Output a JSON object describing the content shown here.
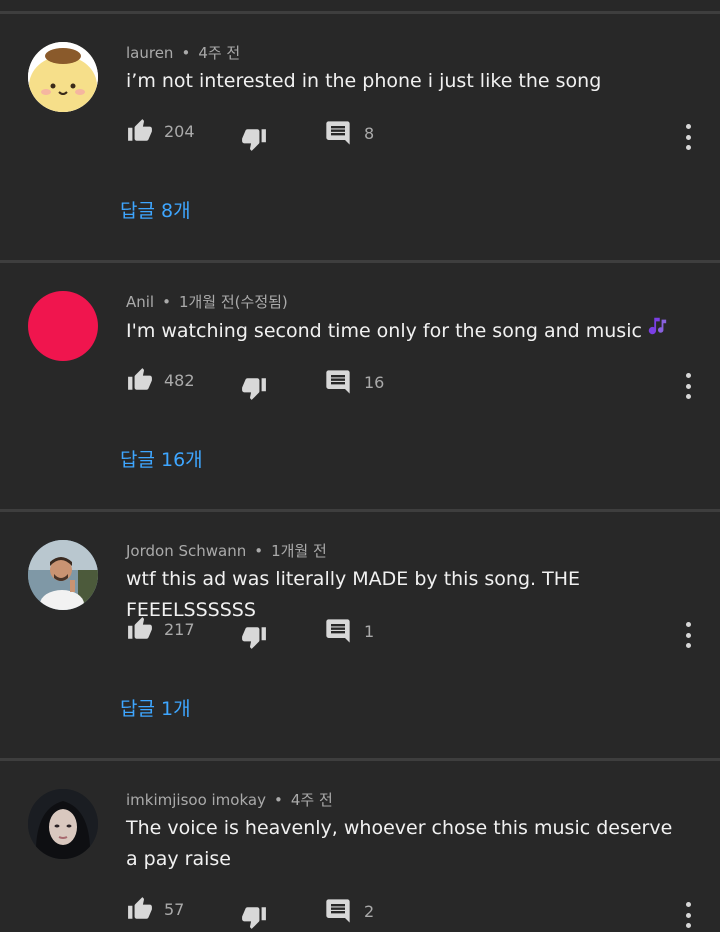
{
  "comments": [
    {
      "author": "lauren",
      "time": "4주 전",
      "text": "i’m not interested in the phone i just like the song",
      "likes": "204",
      "reply_count": "8",
      "replies_label": "답글 8개",
      "avatar": "pompompurin-avatar"
    },
    {
      "author": "Anil",
      "time": "1개월 전(수정됨)",
      "text": "I'm watching second time only for the song and music",
      "likes": "482",
      "reply_count": "16",
      "replies_label": "답글 16개",
      "avatar": "red-circle-avatar"
    },
    {
      "author": "Jordon Schwann",
      "time": "1개월 전",
      "text": "wtf this ad was literally MADE by this song. THE FEEELSSSSSS",
      "likes": "217",
      "reply_count": "1",
      "replies_label": "답글 1개",
      "avatar": "photo-avatar-man"
    },
    {
      "author": "imkimjisoo imokay",
      "time": "4주 전",
      "text": "The voice is heavenly, whoever chose this music deserve a pay raise",
      "likes": "57",
      "reply_count": "2",
      "avatar": "photo-avatar-woman"
    }
  ],
  "colors": {
    "background": "#282828",
    "divider": "#3e3e3e",
    "link": "#3ea6ff",
    "meta": "#aaaaaa"
  }
}
